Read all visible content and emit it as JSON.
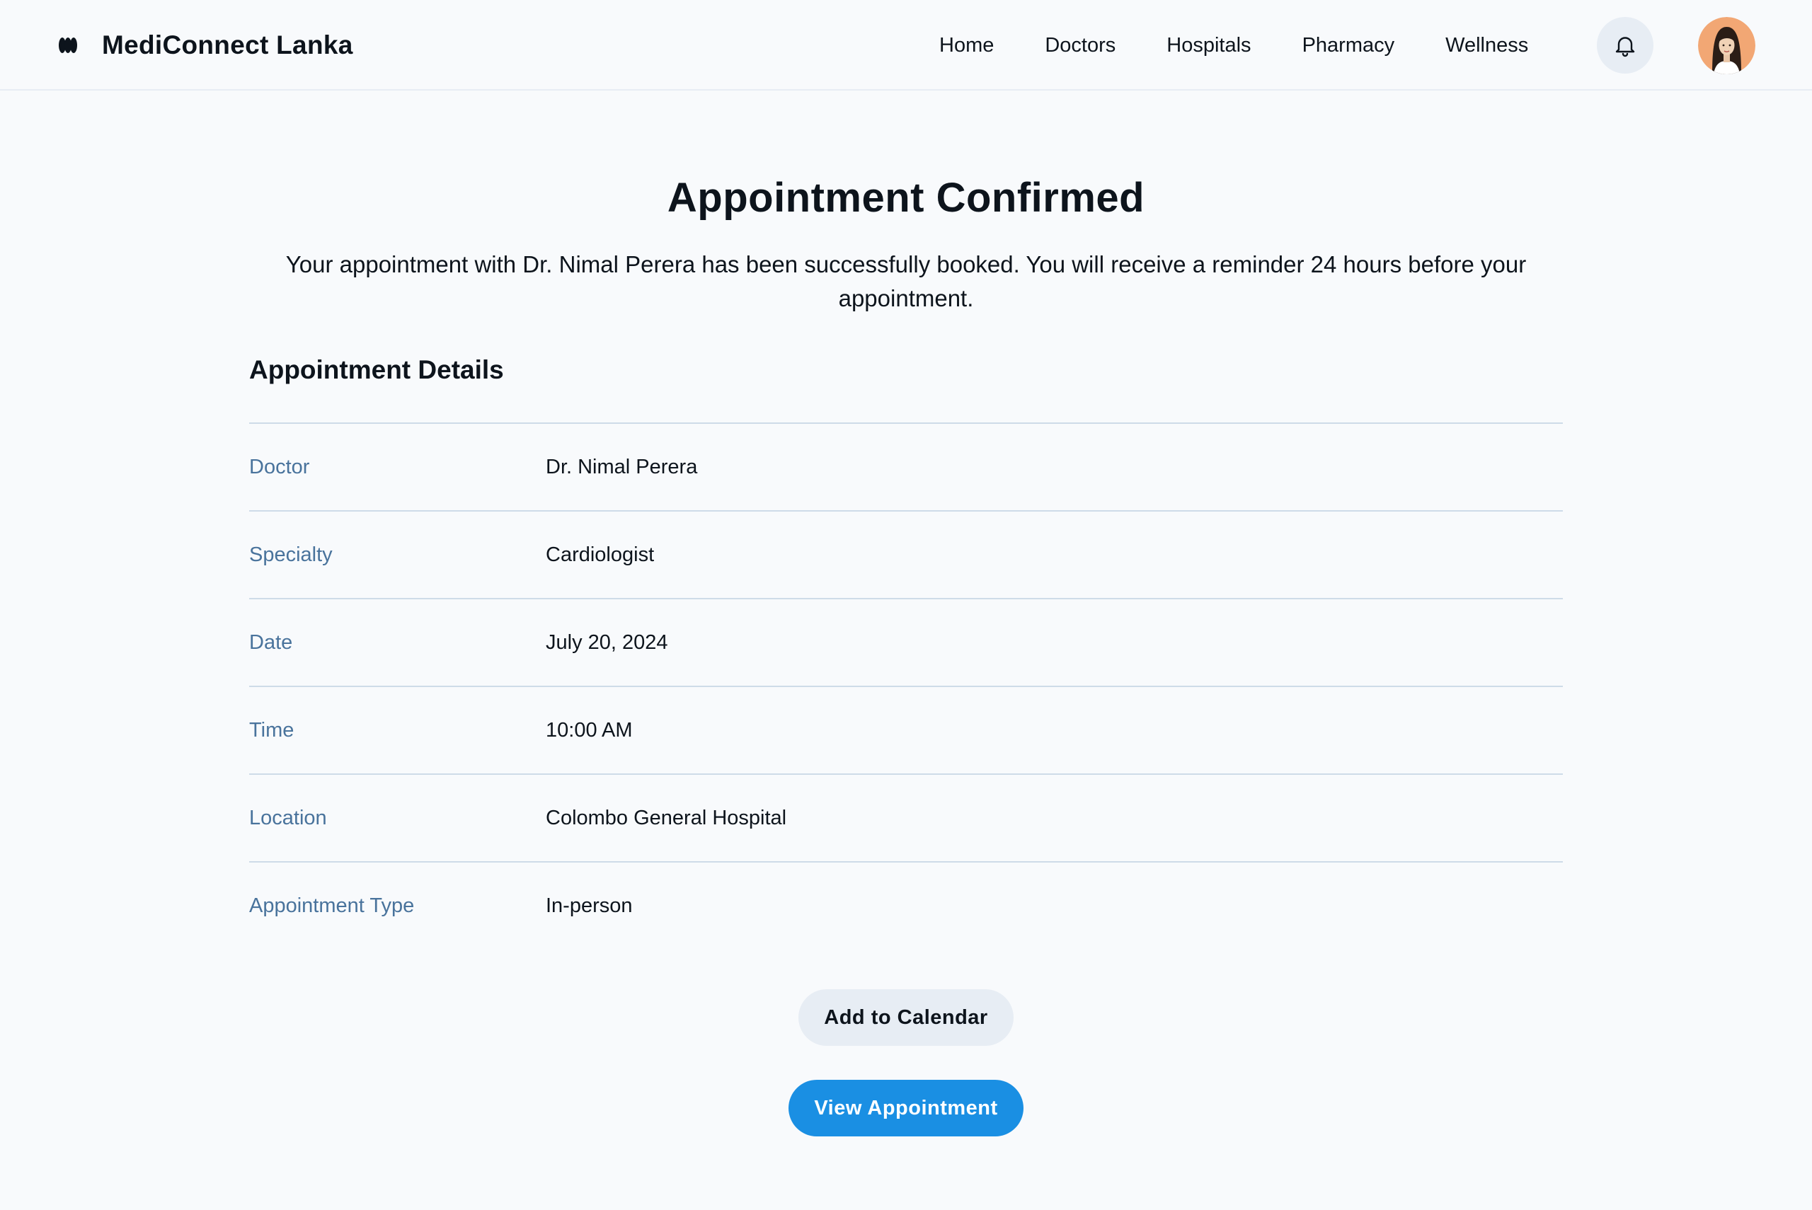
{
  "header": {
    "brand_name": "MediConnect Lanka",
    "logo_icon": "brand-logo-icon",
    "nav": [
      {
        "label": "Home"
      },
      {
        "label": "Doctors"
      },
      {
        "label": "Hospitals"
      },
      {
        "label": "Pharmacy"
      },
      {
        "label": "Wellness"
      }
    ],
    "notification_icon": "bell-icon",
    "avatar_icon": "user-avatar"
  },
  "confirmation": {
    "title": "Appointment Confirmed",
    "message": "Your appointment with Dr. Nimal Perera has been successfully booked. You will receive a reminder 24 hours before your appointment."
  },
  "details": {
    "section_title": "Appointment Details",
    "rows": [
      {
        "label": "Doctor",
        "value": "Dr. Nimal Perera"
      },
      {
        "label": "Specialty",
        "value": "Cardiologist"
      },
      {
        "label": "Date",
        "value": "July 20, 2024"
      },
      {
        "label": "Time",
        "value": "10:00 AM"
      },
      {
        "label": "Location",
        "value": "Colombo General Hospital"
      },
      {
        "label": "Appointment Type",
        "value": "In-person"
      }
    ]
  },
  "actions": {
    "add_to_calendar": "Add to Calendar",
    "view_appointment": "View Appointment"
  },
  "colors": {
    "primary": "#1a8fe3",
    "secondary_button": "#e7edf4",
    "label_text": "#49739c",
    "divider": "#cedbe8",
    "background": "#f8fafc",
    "text": "#0d141c"
  }
}
